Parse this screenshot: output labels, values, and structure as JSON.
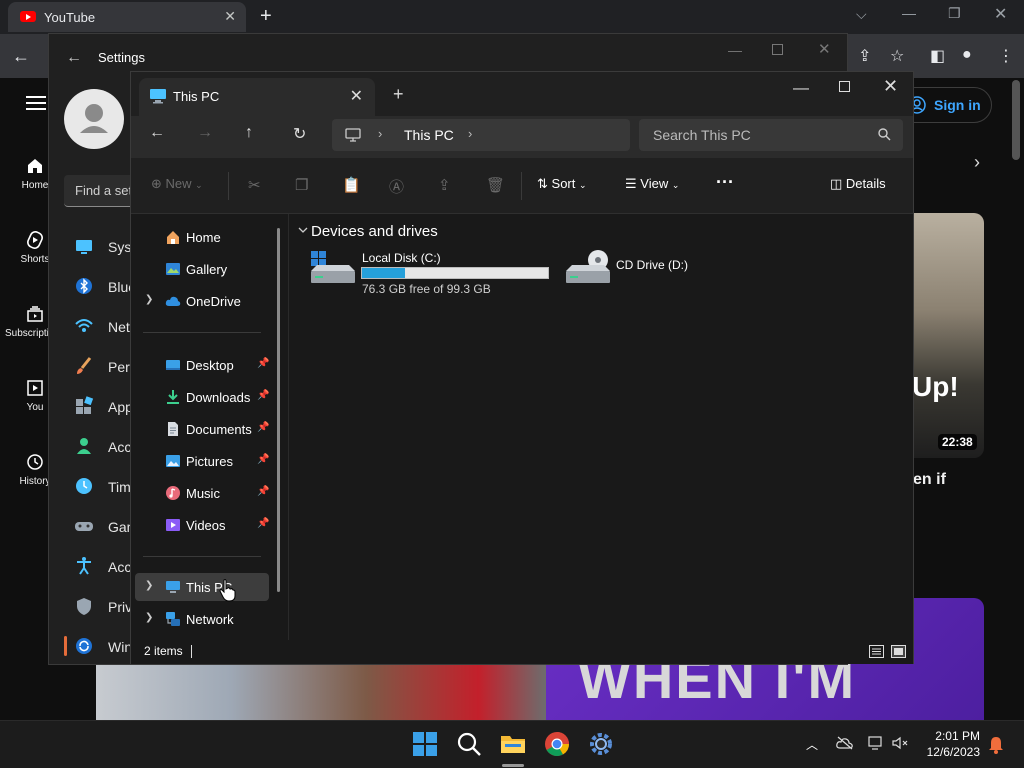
{
  "browser": {
    "tab_title": "YouTube",
    "sign_in_label": "Sign in",
    "sidebar": [
      {
        "label": "Home",
        "icon": "home-icon"
      },
      {
        "label": "Shorts",
        "icon": "shorts-icon"
      },
      {
        "label": "Subscriptions",
        "icon": "subscriptions-icon"
      },
      {
        "label": "You",
        "icon": "you-icon"
      },
      {
        "label": "History",
        "icon": "history-icon"
      }
    ],
    "video_duration": "22:38",
    "thumb_text": "Up!",
    "caption_fragment": "en if",
    "thumb_banner_text": "WHEN I'M"
  },
  "settings": {
    "title": "Settings",
    "search_placeholder": "Find a setting",
    "items": [
      {
        "label": "System",
        "icon": "system-icon"
      },
      {
        "label": "Bluetooth & devices",
        "icon": "bluetooth-icon"
      },
      {
        "label": "Network & internet",
        "icon": "wifi-icon"
      },
      {
        "label": "Personalization",
        "icon": "brush-icon"
      },
      {
        "label": "Apps",
        "icon": "apps-icon"
      },
      {
        "label": "Accounts",
        "icon": "accounts-icon"
      },
      {
        "label": "Time & language",
        "icon": "clock-icon"
      },
      {
        "label": "Gaming",
        "icon": "gamepad-icon"
      },
      {
        "label": "Accessibility",
        "icon": "accessibility-icon"
      },
      {
        "label": "Privacy & security",
        "icon": "shield-icon"
      },
      {
        "label": "Windows Update",
        "icon": "update-icon"
      }
    ]
  },
  "explorer": {
    "tab_title": "This PC",
    "address_crumb": "This PC",
    "search_placeholder": "Search This PC",
    "commands": {
      "new": "New",
      "sort": "Sort",
      "view": "View",
      "details": "Details"
    },
    "nav": {
      "top": [
        {
          "label": "Home",
          "icon": "home-icon"
        },
        {
          "label": "Gallery",
          "icon": "gallery-icon"
        },
        {
          "label": "OneDrive",
          "icon": "cloud-icon"
        }
      ],
      "pinned": [
        {
          "label": "Desktop",
          "icon": "desktop-folder-icon"
        },
        {
          "label": "Downloads",
          "icon": "downloads-icon"
        },
        {
          "label": "Documents",
          "icon": "documents-icon"
        },
        {
          "label": "Pictures",
          "icon": "pictures-icon"
        },
        {
          "label": "Music",
          "icon": "music-icon"
        },
        {
          "label": "Videos",
          "icon": "videos-icon"
        }
      ],
      "bottom": [
        {
          "label": "This PC",
          "icon": "pc-icon"
        },
        {
          "label": "Network",
          "icon": "network-icon"
        }
      ]
    },
    "group_header": "Devices and drives",
    "drives": [
      {
        "name": "Local Disk (C:)",
        "free": "76.3 GB free of 99.3 GB",
        "used_fraction": 0.232
      },
      {
        "name": "CD Drive (D:)"
      }
    ],
    "status": "2 items"
  },
  "taskbar": {
    "time": "2:01 PM",
    "date": "12/6/2023",
    "apps": [
      "start-icon",
      "search-icon",
      "file-explorer-icon",
      "chrome-icon",
      "settings-icon"
    ]
  },
  "colors": {
    "accent_blue": "#26a0da",
    "youtube_red": "#ff0000",
    "link_blue": "#3ea6ff",
    "settings_selected": "#e46c3a"
  }
}
